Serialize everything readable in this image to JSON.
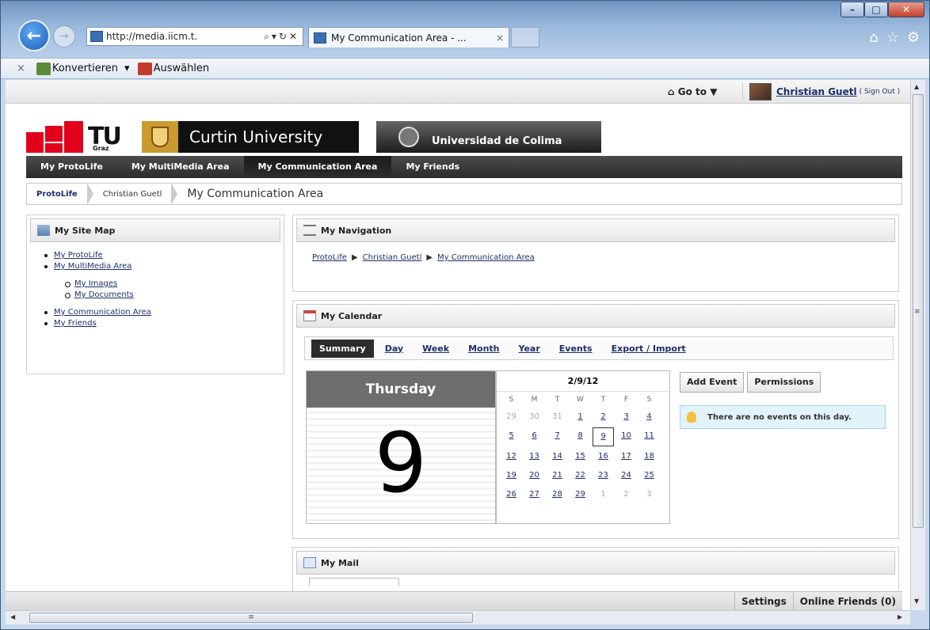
{
  "browser": {
    "address": "http://media.iicm.t.",
    "tab_title": "My Communication Area - ...",
    "tab_close": "×",
    "cmd_convert": "Konvertieren",
    "cmd_select": "Auswählen",
    "cmd_close": "×"
  },
  "site": {
    "goto": "Go to ▼",
    "user_name": "Christian Guetl",
    "sign_out": "( Sign Out )",
    "logos": {
      "tug_text": "TU",
      "tug_sub": "Graz",
      "curtin": "Curtin University",
      "colima": "Universidad de Colima"
    },
    "nav": [
      "My ProtoLife",
      "My MultiMedia Area",
      "My Communication Area",
      "My Friends"
    ],
    "breadcrumb": [
      "ProtoLife",
      "Christian Guetl",
      "My Communication Area"
    ]
  },
  "sitemap": {
    "title": "My Site Map",
    "items": [
      "My ProtoLife",
      "My MultiMedia Area"
    ],
    "subitems": [
      "My Images",
      "My Documents"
    ],
    "items2": [
      "My Communication Area",
      "My Friends"
    ]
  },
  "navigation": {
    "title": "My Navigation",
    "trail": [
      "ProtoLife",
      "Christian Guetl",
      "My Communication Area"
    ]
  },
  "calendar": {
    "title": "My Calendar",
    "tabs": [
      "Summary",
      "Day",
      "Week",
      "Month",
      "Year",
      "Events",
      "Export / Import"
    ],
    "day_name": "Thursday",
    "day_number": "9",
    "month_header": "2/9/12",
    "weekdays": [
      "S",
      "M",
      "T",
      "W",
      "T",
      "F",
      "S"
    ],
    "add_event": "Add Event",
    "permissions": "Permissions",
    "no_events": "There are no events on this day."
  },
  "mail": {
    "title": "My Mail"
  },
  "statusbar": {
    "settings": "Settings",
    "online_friends": "Online Friends (0)"
  }
}
